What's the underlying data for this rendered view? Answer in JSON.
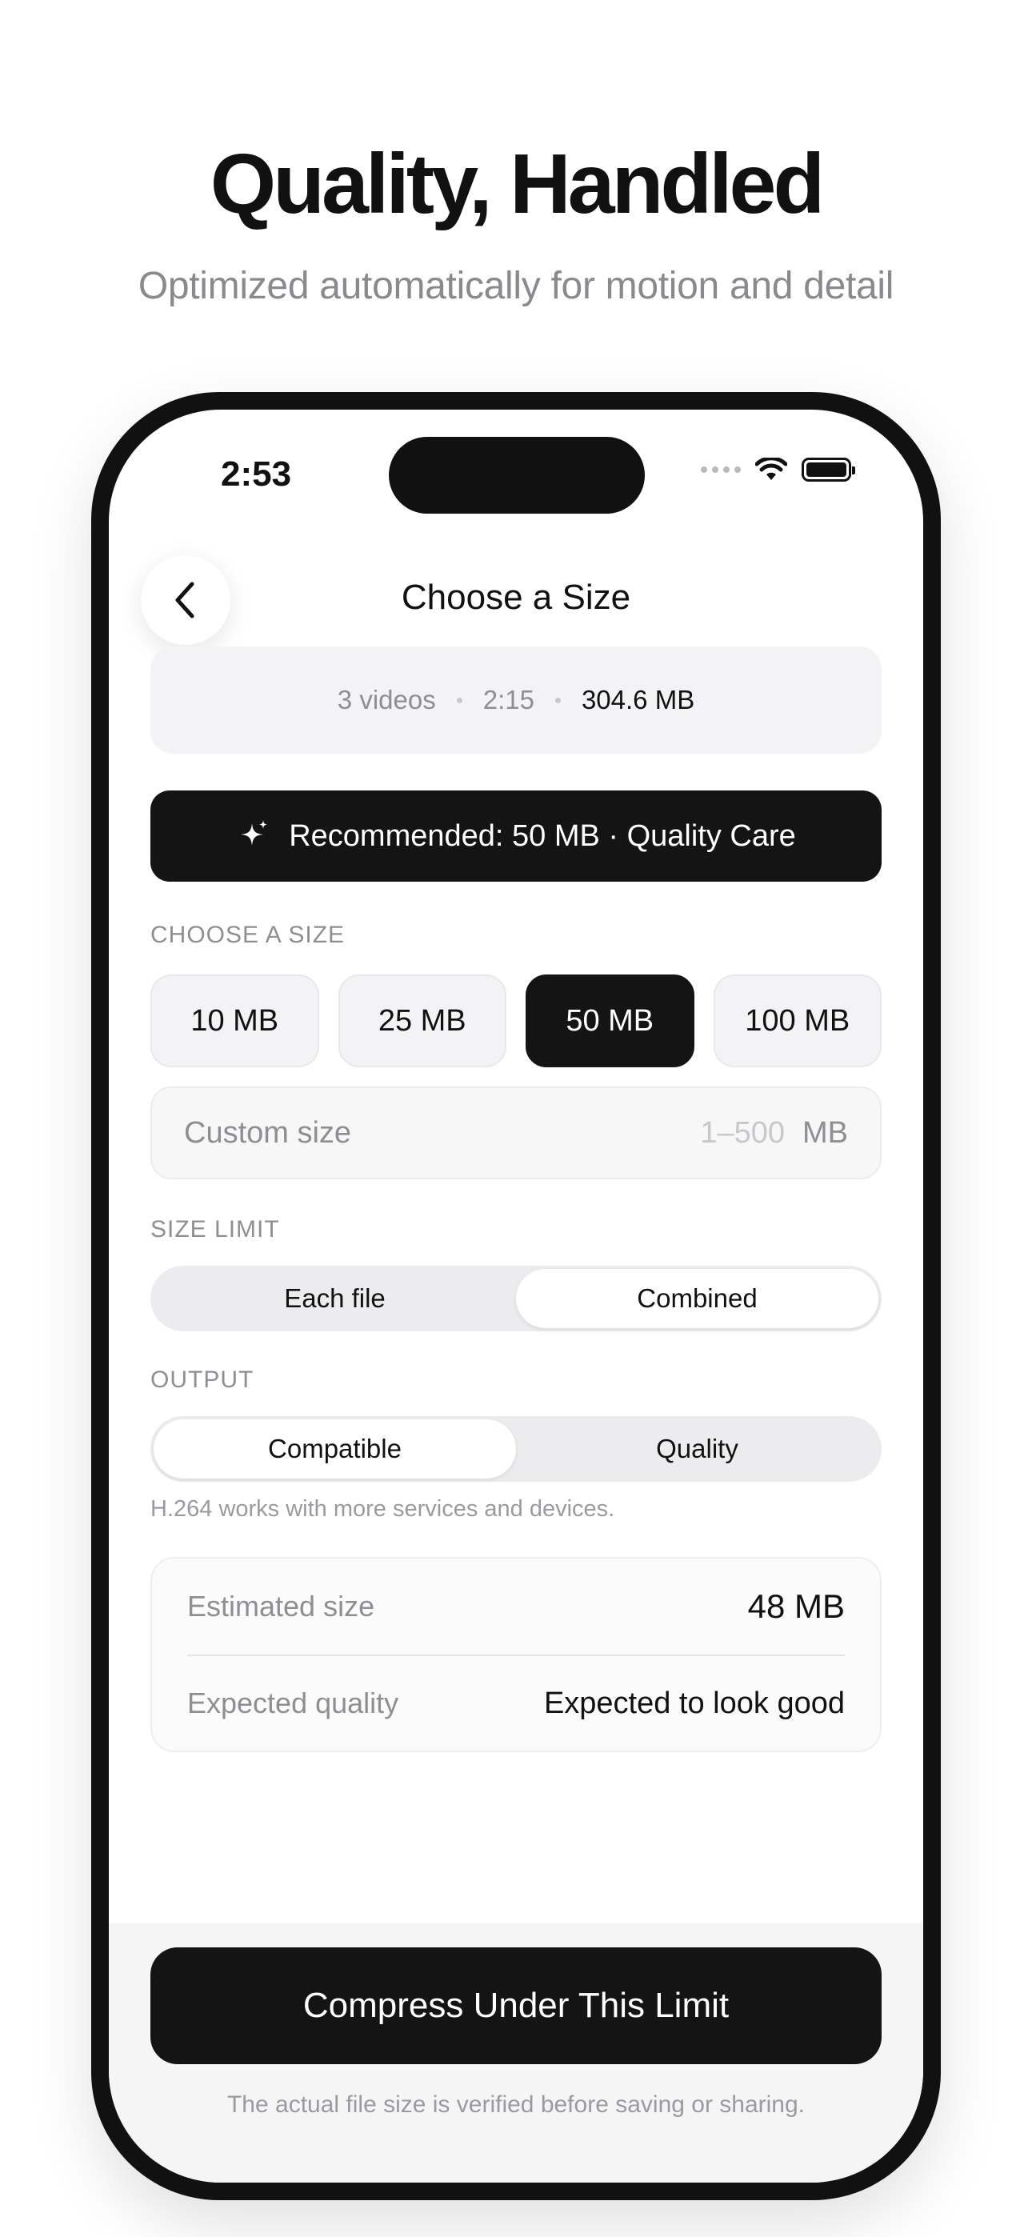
{
  "marketing": {
    "headline": "Quality, Handled",
    "subhead": "Optimized automatically for motion and detail"
  },
  "status_bar": {
    "time": "2:53",
    "icons": [
      "signal-dots-icon",
      "wifi-icon",
      "battery-icon"
    ]
  },
  "nav": {
    "back_icon": "chevron-left-icon",
    "title": "Choose a Size"
  },
  "summary": {
    "count": "3 videos",
    "duration": "2:15",
    "total_size": "304.6 MB"
  },
  "recommendation": {
    "icon": "sparkle-icon",
    "label": "Recommended: 50 MB · Quality Care"
  },
  "size_section": {
    "label": "CHOOSE A SIZE",
    "options": [
      "10 MB",
      "25 MB",
      "50 MB",
      "100 MB"
    ],
    "selected": "50 MB",
    "custom_placeholder": "Custom size",
    "custom_range": "1–500",
    "custom_unit": "MB"
  },
  "size_limit": {
    "label": "SIZE LIMIT",
    "options": [
      "Each file",
      "Combined"
    ],
    "selected": "Combined"
  },
  "output": {
    "label": "OUTPUT",
    "options": [
      "Compatible",
      "Quality"
    ],
    "selected": "Compatible",
    "helper": "H.264 works with more services and devices."
  },
  "estimate": {
    "size_label": "Estimated size",
    "size_value": "48 MB",
    "quality_label": "Expected quality",
    "quality_value": "Expected to look good"
  },
  "action": {
    "cta_label": "Compress Under This Limit",
    "footnote": "The actual file size is verified before saving or sharing."
  },
  "colors": {
    "accent_dark": "#141414",
    "muted_text": "#8e8e93",
    "surface": "#f3f3f5"
  }
}
